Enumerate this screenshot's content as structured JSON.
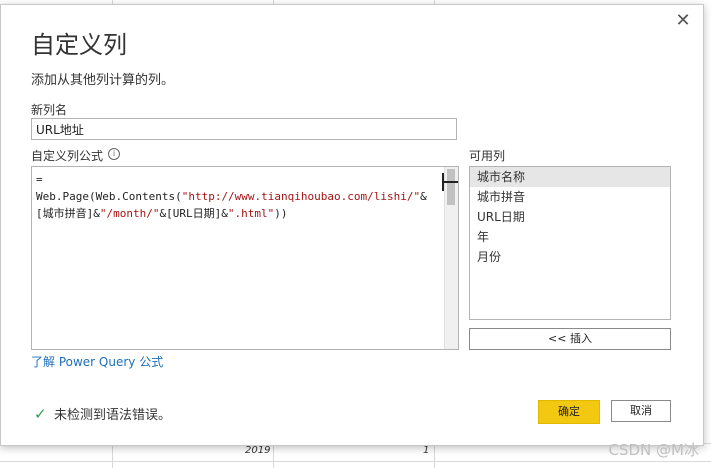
{
  "background": {
    "rows": [
      {
        "year": "2019",
        "value": "1"
      },
      {
        "year": "2019",
        "value": "1"
      }
    ]
  },
  "dialog": {
    "title": "自定义列",
    "close_glyph": "✕",
    "description": "添加从其他列计算的列。",
    "new_column_label": "新列名",
    "new_column_value": "URL地址",
    "formula_label": "自定义列公式",
    "info_glyph": "i",
    "formula": {
      "prefix": "= Web.Page(Web.Contents(",
      "str1": "\"http://www.tianqihoubao.com/lishi/\"",
      "mid1": "&\n[城市拼音]&",
      "str2": "\"/month/\"",
      "mid2": "&[URL日期]&",
      "str3": "\".html\"",
      "suffix": "))"
    },
    "available_columns_label": "可用列",
    "available_columns": [
      "城市名称",
      "城市拼音",
      "URL日期",
      "年",
      "月份"
    ],
    "selected_column_index": 0,
    "insert_button": "<< 插入",
    "learn_link": "了解 Power Query 公式",
    "status_icon": "check-icon",
    "status_text": "未检测到语法错误。",
    "ok_button": "确定",
    "cancel_button": "取消",
    "accent_color": "#f2c811"
  },
  "watermark": "CSDN @M冰"
}
